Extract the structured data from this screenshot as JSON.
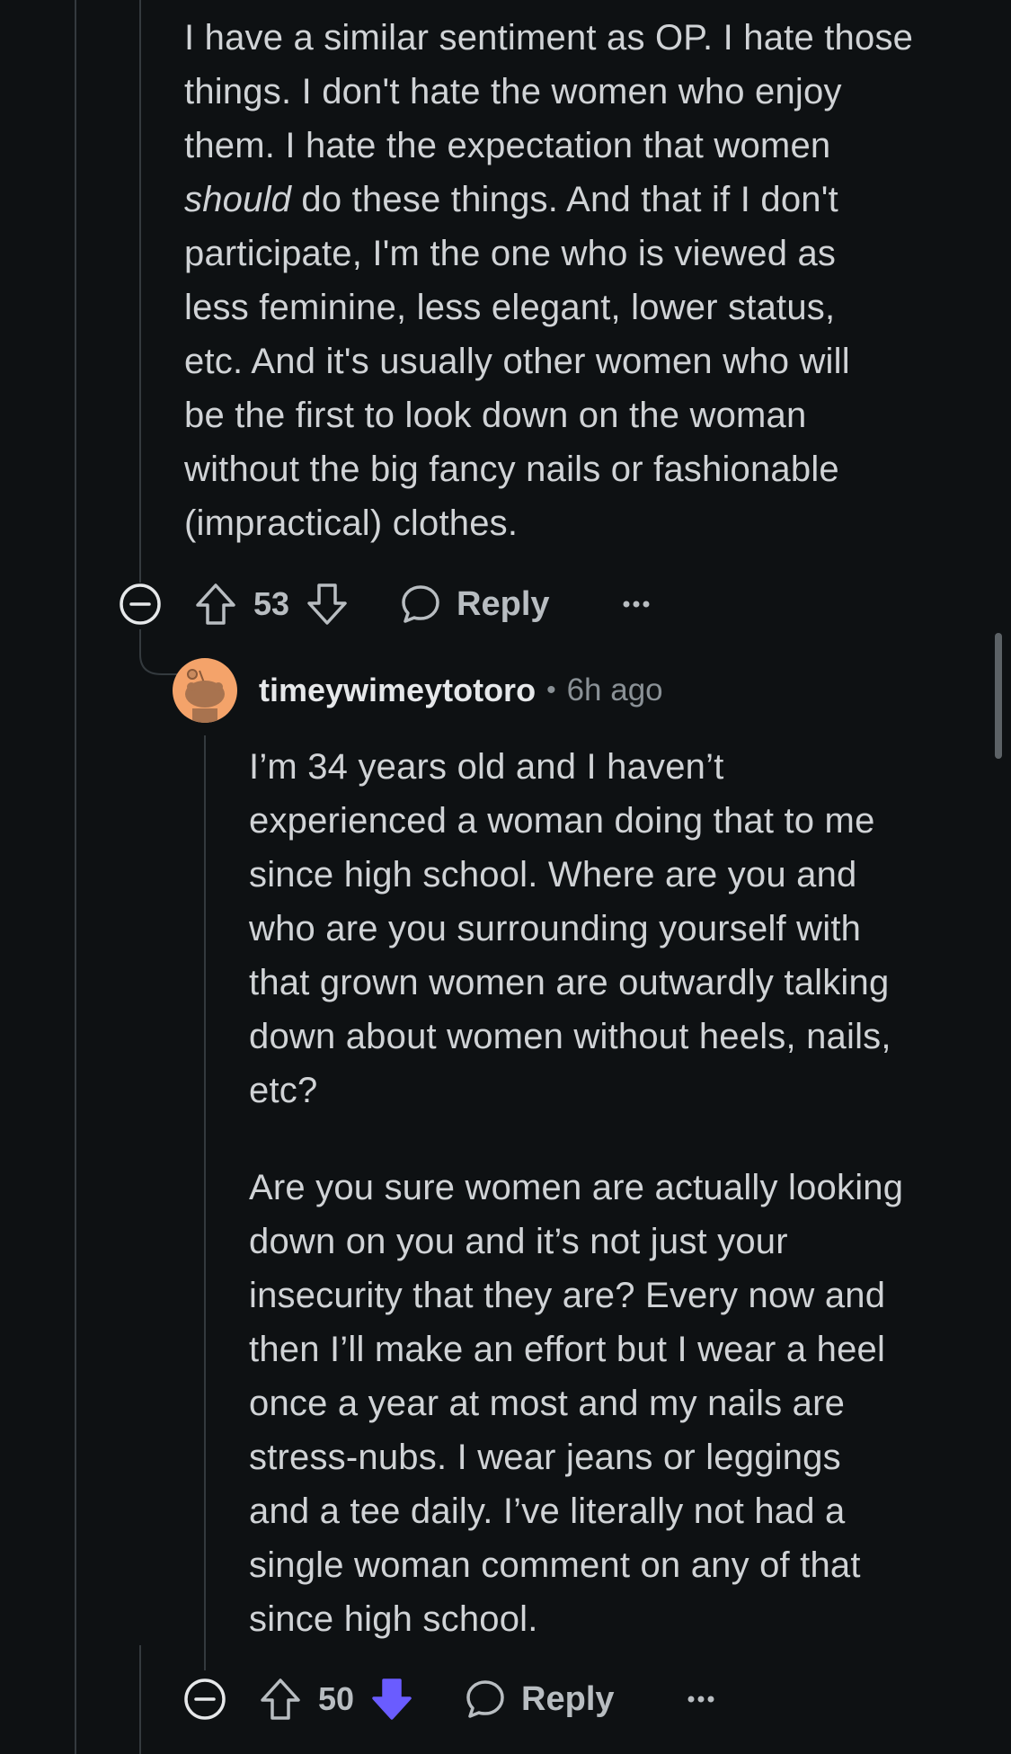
{
  "parent_comment": {
    "text_lines": [
      "I have a similar sentiment as OP. I hate those",
      "things. I don't hate the women who enjoy",
      "them. I hate the expectation that women",
      "do these things. And that if I don't",
      "participate, I'm the one who is viewed as",
      "less feminine, less elegant, lower status,",
      "etc. And it's usually other women who will",
      "be the first to look down on the woman",
      "without the big fancy nails or fashionable",
      "(impractical) clothes."
    ],
    "emphasis_word": "should",
    "score": "53",
    "reply_label": "Reply"
  },
  "reply_comment": {
    "username": "timeywimeytotoro",
    "separator": "•",
    "time": "6h ago",
    "paragraph1_lines": [
      "I’m 34 years old and I haven’t",
      "experienced a woman doing that to me",
      "since high school. Where are you and",
      "who are you surrounding yourself with",
      "that grown women are outwardly talking",
      "down about women without heels, nails,",
      "etc?"
    ],
    "paragraph2_lines": [
      "Are you sure women are actually looking",
      "down on you and it’s not just your",
      "insecurity that they are? Every now and",
      "then I’ll make an effort but I wear a heel",
      "once a year at most and my nails are",
      "stress-nubs. I wear jeans or leggings",
      "and a tee daily. I’ve literally not had a",
      "single woman comment on any of that",
      "since high school."
    ],
    "score": "50",
    "reply_label": "Reply",
    "downvoted": true
  },
  "icons": {
    "collapse": "minus-circle-icon",
    "upvote": "arrow-up-icon",
    "downvote": "arrow-down-icon",
    "reply": "speech-bubble-icon",
    "more": "more-horizontal-icon",
    "avatar": "snoo-avatar-icon"
  },
  "colors": {
    "background": "#0e1113",
    "downvote_active": "#6a5cff",
    "avatar_bg": "#f4a36a"
  }
}
